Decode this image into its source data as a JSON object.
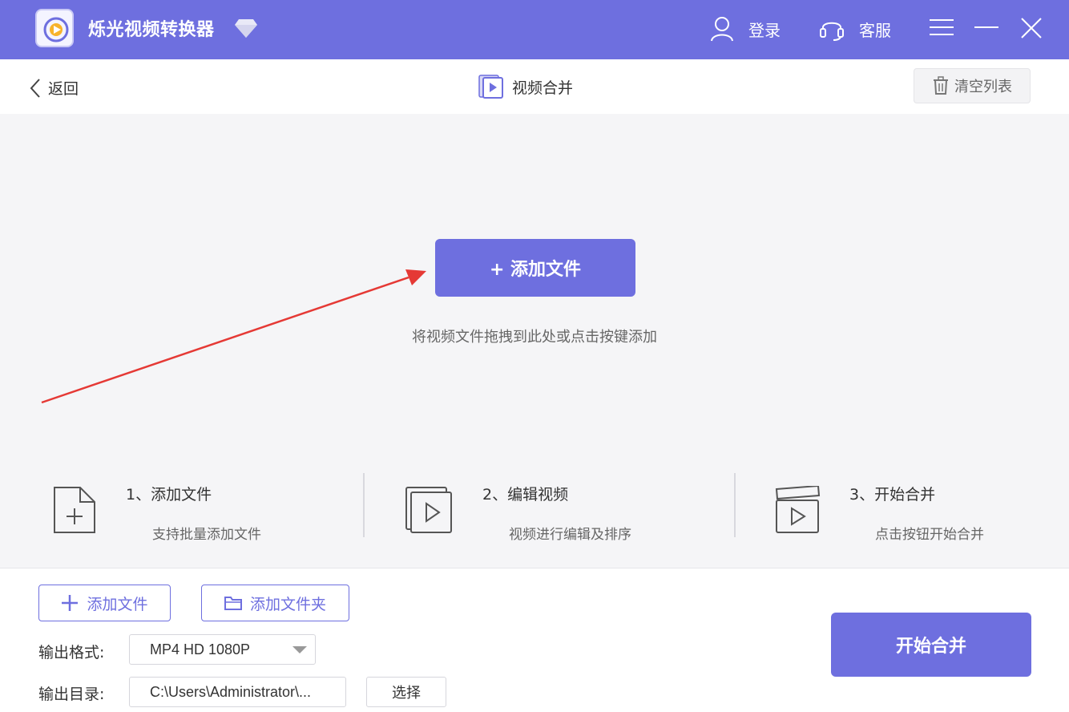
{
  "titlebar": {
    "app_title": "烁光视频转换器",
    "login_label": "登录",
    "service_label": "客服"
  },
  "subheader": {
    "back_label": "返回",
    "page_title": "视频合并",
    "clear_label": "清空列表"
  },
  "drop_area": {
    "add_button_label": "+ 添加文件",
    "hint": "将视频文件拖拽到此处或点击按键添加"
  },
  "steps": [
    {
      "title": "1、添加文件",
      "desc": "支持批量添加文件",
      "icon": "file-add-icon"
    },
    {
      "title": "2、编辑视频",
      "desc": "视频进行编辑及排序",
      "icon": "video-stack-icon"
    },
    {
      "title": "3、开始合并",
      "desc": "点击按钮开始合并",
      "icon": "clapper-icon"
    }
  ],
  "bottom": {
    "add_file_label": "添加文件",
    "add_folder_label": "添加文件夹",
    "format_label": "输出格式:",
    "format_value": "MP4 HD 1080P",
    "dir_label": "输出目录:",
    "dir_value": "C:\\Users\\Administrator\\...",
    "choose_label": "选择",
    "start_label": "开始合并"
  },
  "colors": {
    "accent": "#6e6fdf",
    "arrow": "#e53935"
  }
}
